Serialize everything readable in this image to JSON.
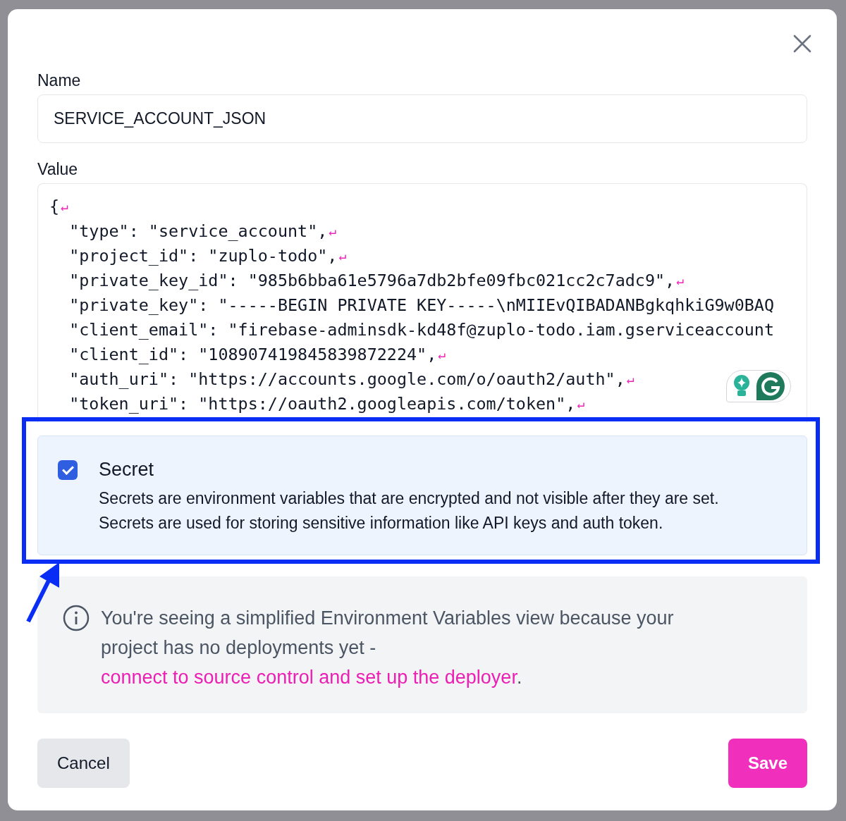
{
  "name_field": {
    "label": "Name",
    "value": "SERVICE_ACCOUNT_JSON"
  },
  "value_field": {
    "label": "Value",
    "lines": [
      {
        "text": "{",
        "newline_mark": "↵"
      },
      {
        "text": "  \"type\": \"service_account\",",
        "newline_mark": "↵"
      },
      {
        "text": "  \"project_id\": \"zuplo-todo\",",
        "newline_mark": "↵"
      },
      {
        "text": "  \"private_key_id\": \"985b6bba61e5796a7db2bfe09fbc021cc2c7adc9\",",
        "newline_mark": "↵"
      },
      {
        "text": "  \"private_key\": \"-----BEGIN PRIVATE KEY-----\\nMIIEvQIBADANBgkqhkiG9w0BAQ"
      },
      {
        "text": "  \"client_email\": \"firebase-adminsdk-kd48f@zuplo-todo.iam.gserviceaccount"
      },
      {
        "text": "  \"client_id\": \"108907419845839872224\",",
        "newline_mark": "↵"
      },
      {
        "text": "  \"auth_uri\": \"https://accounts.google.com/o/oauth2/auth\",",
        "newline_mark": "↵"
      },
      {
        "text": "  \"token_uri\": \"https://oauth2.googleapis.com/token\",",
        "newline_mark": "↵"
      }
    ]
  },
  "secret": {
    "label": "Secret",
    "checked": true,
    "description": "Secrets are environment variables that are encrypted and not visible after they are set. Secrets are used for storing sensitive information like API keys and auth token."
  },
  "notice": {
    "text": "You're seeing a simplified Environment Variables view because your project has no deployments yet - ",
    "link": "connect to source control and set up the deployer",
    "after": "."
  },
  "buttons": [
    {
      "label": "Cancel",
      "kind": "secondary"
    },
    {
      "label": "Save",
      "kind": "primary"
    }
  ]
}
